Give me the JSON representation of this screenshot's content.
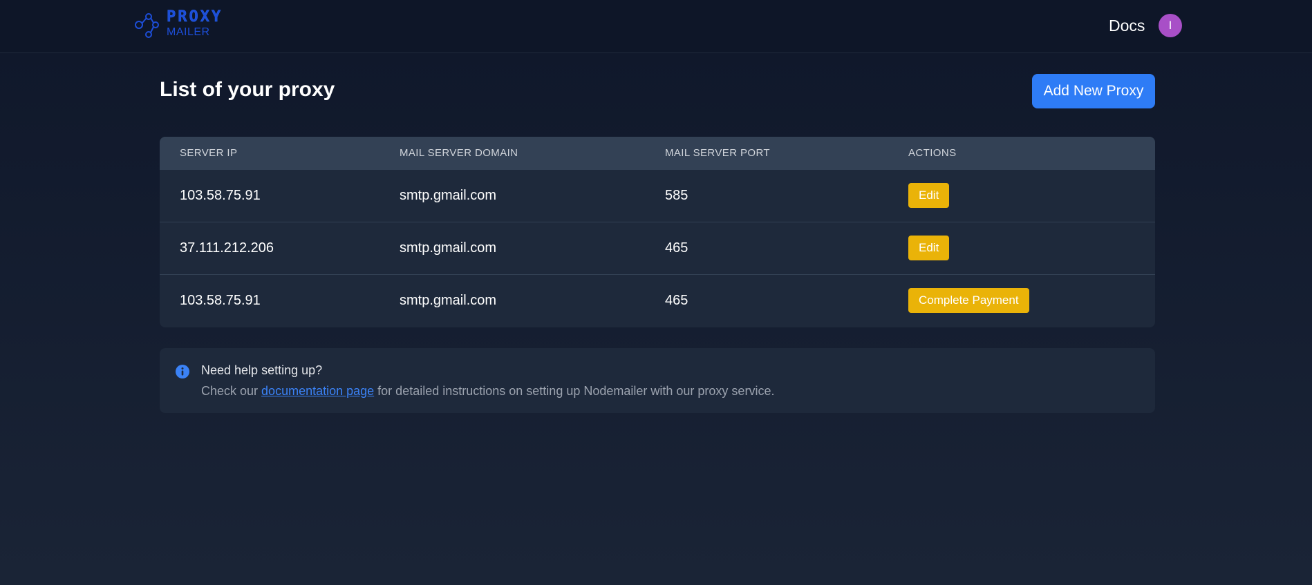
{
  "navbar": {
    "logo_word": "PROXY",
    "logo_sub": "MAILER",
    "docs_label": "Docs",
    "avatar_initial": "I"
  },
  "page": {
    "title": "List of your proxy",
    "add_button": "Add New Proxy"
  },
  "table": {
    "headers": [
      "SERVER IP",
      "MAIL SERVER DOMAIN",
      "MAIL SERVER PORT",
      "ACTIONS"
    ],
    "rows": [
      {
        "server_ip": "103.58.75.91",
        "domain": "smtp.gmail.com",
        "port": "585",
        "action": "Edit"
      },
      {
        "server_ip": "37.111.212.206",
        "domain": "smtp.gmail.com",
        "port": "465",
        "action": "Edit"
      },
      {
        "server_ip": "103.58.75.91",
        "domain": "smtp.gmail.com",
        "port": "465",
        "action": "Complete Payment"
      }
    ]
  },
  "help": {
    "title": "Need help setting up?",
    "text_before": "Check our ",
    "link_label": "documentation page",
    "text_after": " for detailed instructions on setting up Nodemailer with our proxy service.",
    "icon": "info-icon"
  },
  "colors": {
    "background": "#0f172a",
    "card": "#1e293b",
    "header_row": "#334155",
    "primary": "#2e7cf6",
    "warning": "#eab308",
    "avatar": "#a84fc7"
  }
}
